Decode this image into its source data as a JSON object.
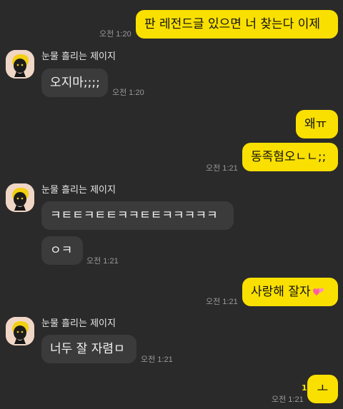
{
  "chat": {
    "messages": [
      {
        "text": "판 레전드글 있으면 너 찾는다 이제",
        "time": "오전 1:20"
      },
      {
        "sender": "눈물 흘리는 제이지",
        "text": "오지마;;;;",
        "time": "오전 1:20"
      },
      {
        "text": "왜ㅠ"
      },
      {
        "text": "동족혐오ㄴㄴ;;",
        "time": "오전 1:21"
      },
      {
        "sender": "눈물 흘리는 제이지",
        "text": "ㅋㅌㅌㅋㅌㅌㅋㅋㅌㅌㅋㅋㅋㅋㅋ"
      },
      {
        "text": "ㅇㅋ",
        "time": "오전 1:21"
      },
      {
        "text": "사랑해 잘자",
        "emoji": "two-hearts-icon",
        "time": "오전 1:21"
      },
      {
        "sender": "눈물 흘리는 제이지",
        "text": "너두 잘 자렴ㅁ",
        "time": "오전 1:21"
      },
      {
        "unread": "1",
        "text": "ㅗ",
        "time": "오전 1:21"
      }
    ]
  },
  "colors": {
    "background": "#2a2a2a",
    "outgoing_bubble": "#f9e000",
    "incoming_bubble": "#3b3b3b",
    "timestamp": "#9a9a9a",
    "unread": "#f9e000"
  }
}
